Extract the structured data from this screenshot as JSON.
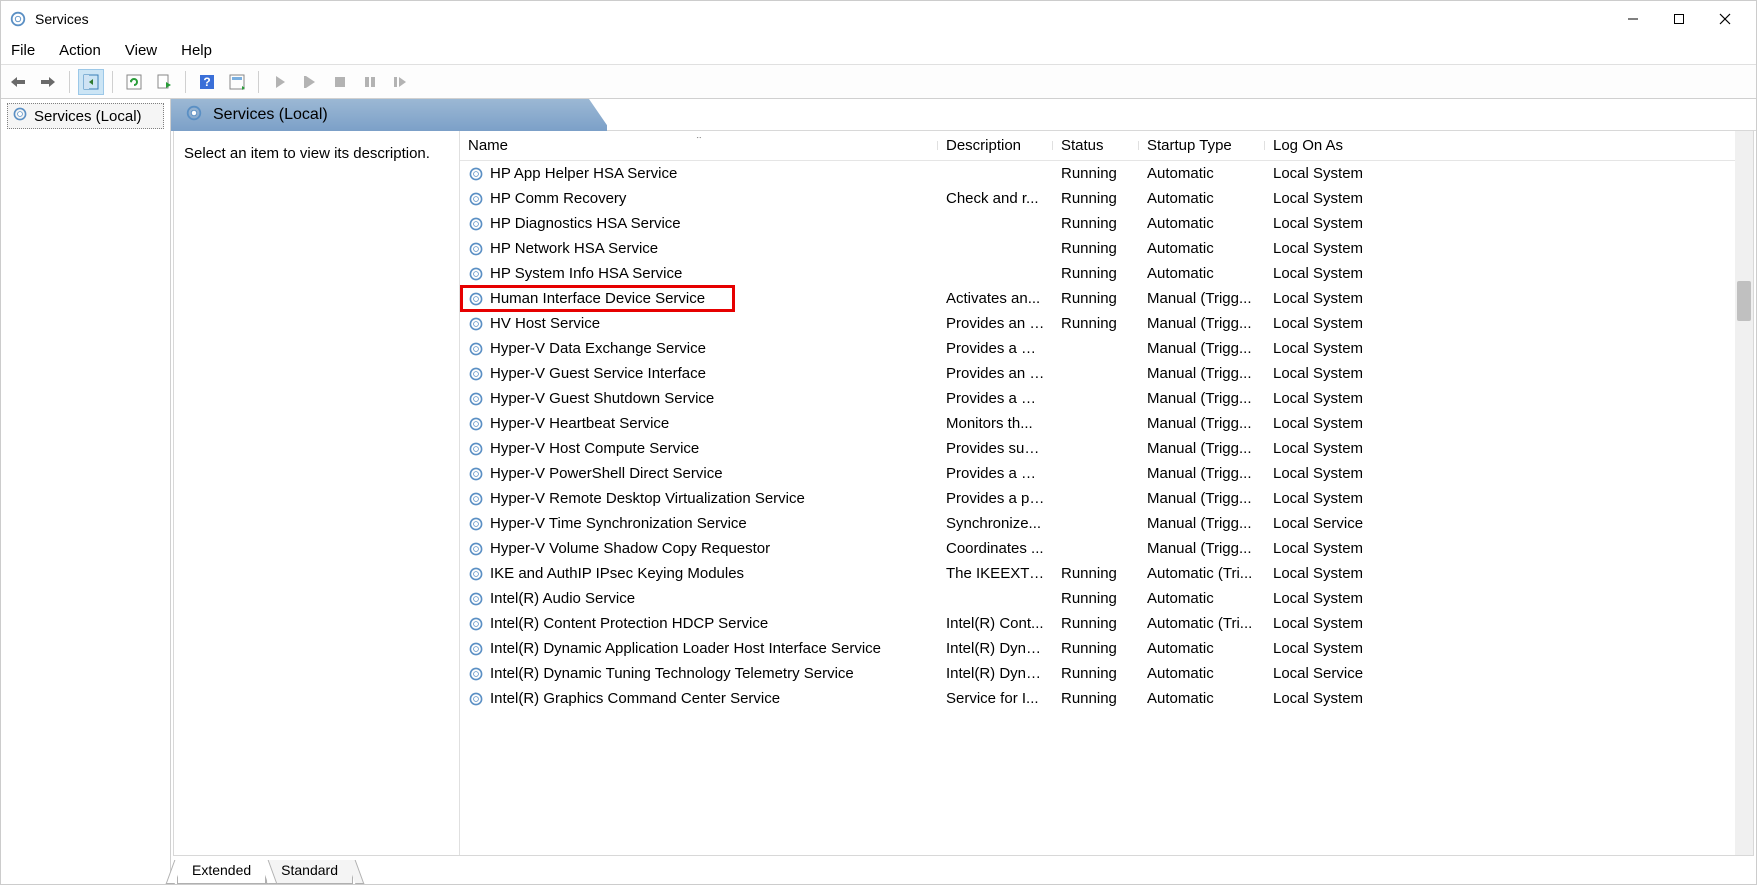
{
  "window": {
    "title": "Services"
  },
  "menu": {
    "file": "File",
    "action": "Action",
    "view": "View",
    "help": "Help"
  },
  "toolbar_icons": {
    "back": "back-arrow",
    "forward": "forward-arrow",
    "show_hide": "show-hide-tree",
    "export": "export-list",
    "refresh": "refresh",
    "help": "help",
    "properties": "properties",
    "start": "start",
    "stop": "stop",
    "pause": "pause",
    "restart": "restart"
  },
  "tree": {
    "root": "Services (Local)"
  },
  "content_header": "Services (Local)",
  "description_placeholder": "Select an item to view its description.",
  "columns": {
    "name": "Name",
    "description": "Description",
    "status": "Status",
    "startup": "Startup Type",
    "logon": "Log On As"
  },
  "rows": [
    {
      "name": "HP App Helper HSA Service",
      "description": "",
      "status": "Running",
      "startup": "Automatic",
      "logon": "Local System"
    },
    {
      "name": "HP Comm Recovery",
      "description": "Check and r...",
      "status": "Running",
      "startup": "Automatic",
      "logon": "Local System"
    },
    {
      "name": "HP Diagnostics HSA Service",
      "description": "",
      "status": "Running",
      "startup": "Automatic",
      "logon": "Local System"
    },
    {
      "name": "HP Network HSA Service",
      "description": "",
      "status": "Running",
      "startup": "Automatic",
      "logon": "Local System"
    },
    {
      "name": "HP System Info HSA Service",
      "description": "",
      "status": "Running",
      "startup": "Automatic",
      "logon": "Local System"
    },
    {
      "name": "Human Interface Device Service",
      "description": "Activates an...",
      "status": "Running",
      "startup": "Manual (Trigg...",
      "logon": "Local System",
      "highlighted": true
    },
    {
      "name": "HV Host Service",
      "description": "Provides an i...",
      "status": "Running",
      "startup": "Manual (Trigg...",
      "logon": "Local System"
    },
    {
      "name": "Hyper-V Data Exchange Service",
      "description": "Provides a m...",
      "status": "",
      "startup": "Manual (Trigg...",
      "logon": "Local System"
    },
    {
      "name": "Hyper-V Guest Service Interface",
      "description": "Provides an i...",
      "status": "",
      "startup": "Manual (Trigg...",
      "logon": "Local System"
    },
    {
      "name": "Hyper-V Guest Shutdown Service",
      "description": "Provides a m...",
      "status": "",
      "startup": "Manual (Trigg...",
      "logon": "Local System"
    },
    {
      "name": "Hyper-V Heartbeat Service",
      "description": "Monitors th...",
      "status": "",
      "startup": "Manual (Trigg...",
      "logon": "Local System"
    },
    {
      "name": "Hyper-V Host Compute Service",
      "description": "Provides sup...",
      "status": "",
      "startup": "Manual (Trigg...",
      "logon": "Local System"
    },
    {
      "name": "Hyper-V PowerShell Direct Service",
      "description": "Provides a m...",
      "status": "",
      "startup": "Manual (Trigg...",
      "logon": "Local System"
    },
    {
      "name": "Hyper-V Remote Desktop Virtualization Service",
      "description": "Provides a pl...",
      "status": "",
      "startup": "Manual (Trigg...",
      "logon": "Local System"
    },
    {
      "name": "Hyper-V Time Synchronization Service",
      "description": "Synchronize...",
      "status": "",
      "startup": "Manual (Trigg...",
      "logon": "Local Service"
    },
    {
      "name": "Hyper-V Volume Shadow Copy Requestor",
      "description": "Coordinates ...",
      "status": "",
      "startup": "Manual (Trigg...",
      "logon": "Local System"
    },
    {
      "name": "IKE and AuthIP IPsec Keying Modules",
      "description": "The IKEEXT s...",
      "status": "Running",
      "startup": "Automatic (Tri...",
      "logon": "Local System"
    },
    {
      "name": "Intel(R) Audio Service",
      "description": "",
      "status": "Running",
      "startup": "Automatic",
      "logon": "Local System"
    },
    {
      "name": "Intel(R) Content Protection HDCP Service",
      "description": "Intel(R) Cont...",
      "status": "Running",
      "startup": "Automatic (Tri...",
      "logon": "Local System"
    },
    {
      "name": "Intel(R) Dynamic Application Loader Host Interface Service",
      "description": "Intel(R) Dyna...",
      "status": "Running",
      "startup": "Automatic",
      "logon": "Local System"
    },
    {
      "name": "Intel(R) Dynamic Tuning Technology Telemetry Service",
      "description": "Intel(R) Dyna...",
      "status": "Running",
      "startup": "Automatic",
      "logon": "Local Service"
    },
    {
      "name": "Intel(R) Graphics Command Center Service",
      "description": "Service for I...",
      "status": "Running",
      "startup": "Automatic",
      "logon": "Local System"
    }
  ],
  "tabs": {
    "extended": "Extended",
    "standard": "Standard"
  }
}
